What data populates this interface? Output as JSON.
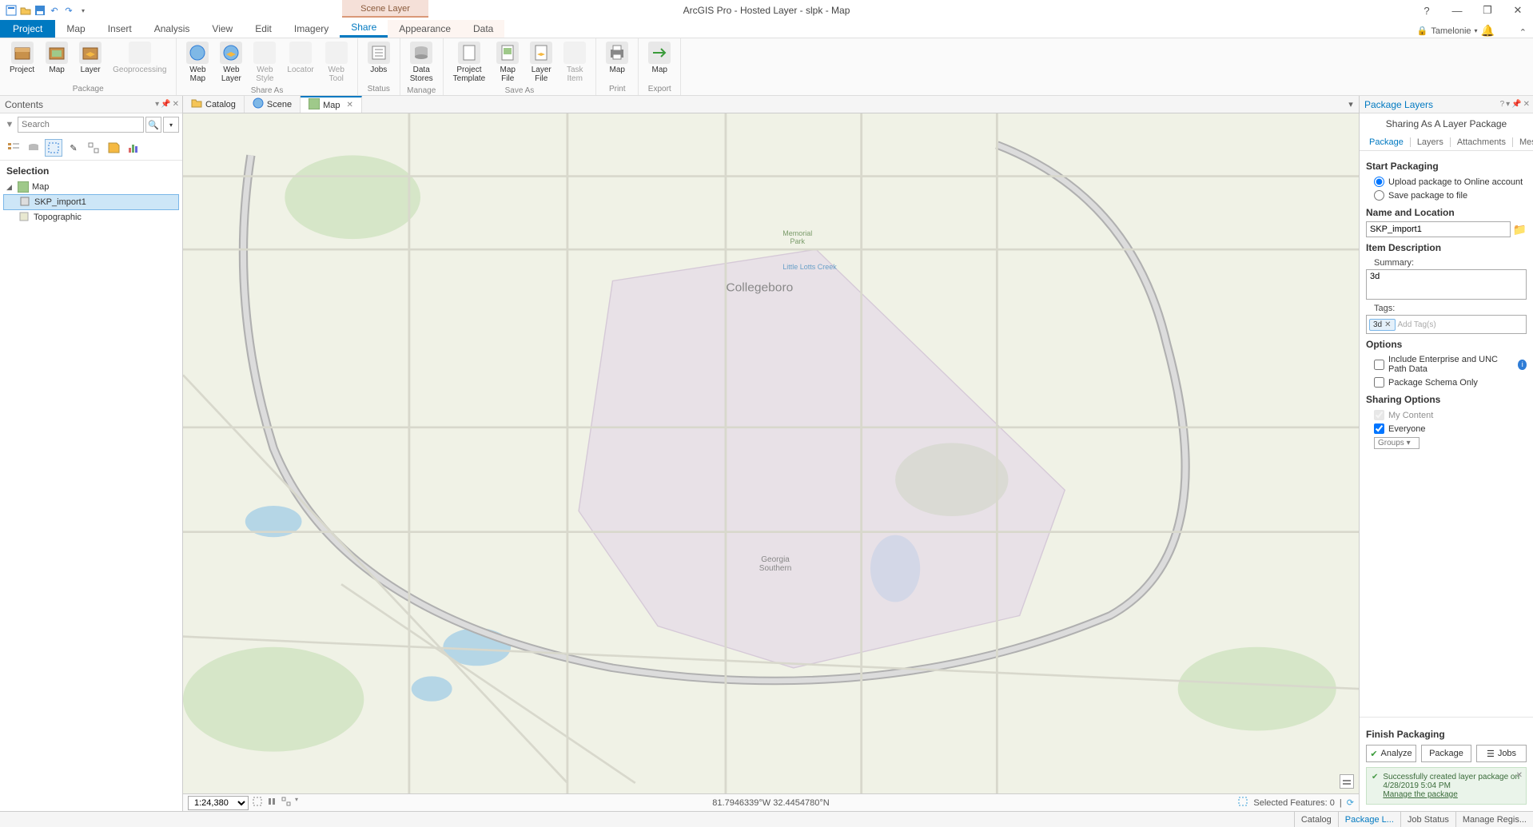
{
  "app_title": "ArcGIS Pro - Hosted Layer - slpk - Map",
  "contextual_tab_title": "Scene Layer",
  "user_name": "Tamelonie",
  "ribbon_tabs": {
    "file": "Project",
    "items": [
      "Map",
      "Insert",
      "Analysis",
      "View",
      "Edit",
      "Imagery",
      "Share",
      "Appearance",
      "Data"
    ],
    "active": "Share"
  },
  "ribbon_groups": {
    "package": {
      "title": "Package",
      "buttons": [
        {
          "label": "Project"
        },
        {
          "label": "Map"
        },
        {
          "label": "Layer"
        },
        {
          "label": "Geoprocessing",
          "disabled": true
        }
      ]
    },
    "share_as": {
      "title": "Share As",
      "buttons": [
        {
          "label": "Web\nMap"
        },
        {
          "label": "Web\nLayer"
        },
        {
          "label": "Web\nStyle",
          "disabled": true
        },
        {
          "label": "Locator",
          "disabled": true
        },
        {
          "label": "Web\nTool",
          "disabled": true
        }
      ]
    },
    "status": {
      "title": "Status",
      "buttons": [
        {
          "label": "Jobs"
        }
      ]
    },
    "manage": {
      "title": "Manage",
      "buttons": [
        {
          "label": "Data\nStores"
        }
      ]
    },
    "save_as": {
      "title": "Save As",
      "buttons": [
        {
          "label": "Project\nTemplate"
        },
        {
          "label": "Map\nFile"
        },
        {
          "label": "Layer\nFile"
        },
        {
          "label": "Task\nItem",
          "disabled": true
        }
      ]
    },
    "print": {
      "title": "Print",
      "buttons": [
        {
          "label": "Map"
        }
      ]
    },
    "export": {
      "title": "Export",
      "buttons": [
        {
          "label": "Map"
        }
      ]
    }
  },
  "contents": {
    "title": "Contents",
    "search_placeholder": "Search",
    "section": "Selection",
    "tree": {
      "root": "Map",
      "children": [
        {
          "label": "SKP_import1",
          "selected": true
        },
        {
          "label": "Topographic"
        }
      ]
    }
  },
  "view_tabs": [
    {
      "label": "Catalog",
      "icon": "catalog"
    },
    {
      "label": "Scene",
      "icon": "globe"
    },
    {
      "label": "Map",
      "icon": "map",
      "active": true,
      "closable": true
    }
  ],
  "map_status": {
    "scale": "1:24,380",
    "coords": "81.7946339°W 32.4454780°N",
    "selected": "Selected Features: 0"
  },
  "map_labels": {
    "collegeboro": "Collegeboro",
    "gs": "Georgia\nSouthern",
    "park": "Memorial\nPark",
    "creek": "Little Lotts Creek"
  },
  "package_pane": {
    "title": "Package Layers",
    "subtitle": "Sharing As A Layer Package",
    "tabs": [
      "Package",
      "Layers",
      "Attachments",
      "Messages"
    ],
    "active_tab": "Package",
    "headings": {
      "start": "Start Packaging",
      "name": "Name and Location",
      "desc": "Item Description",
      "options": "Options",
      "sharing": "Sharing Options",
      "finish": "Finish Packaging"
    },
    "radios": {
      "upload": "Upload package to Online account",
      "save": "Save package to file"
    },
    "name_value": "SKP_import1",
    "summary_label": "Summary:",
    "summary_value": "3d",
    "tags_label": "Tags:",
    "tags": [
      "3d"
    ],
    "tags_placeholder": "Add Tag(s)",
    "opts": {
      "enterprise": "Include Enterprise and UNC Path Data",
      "schema": "Package Schema Only"
    },
    "sharing": {
      "my_content": "My Content",
      "everyone": "Everyone",
      "groups": "Groups"
    },
    "buttons": {
      "analyze": "Analyze",
      "package": "Package",
      "jobs": "Jobs"
    },
    "success": {
      "line1": "Successfully created layer package on",
      "line2": "4/28/2019 5:04 PM",
      "link": "Manage the package"
    }
  },
  "bottom_tabs": [
    "Catalog",
    "Package L...",
    "Job Status",
    "Manage Regis..."
  ]
}
